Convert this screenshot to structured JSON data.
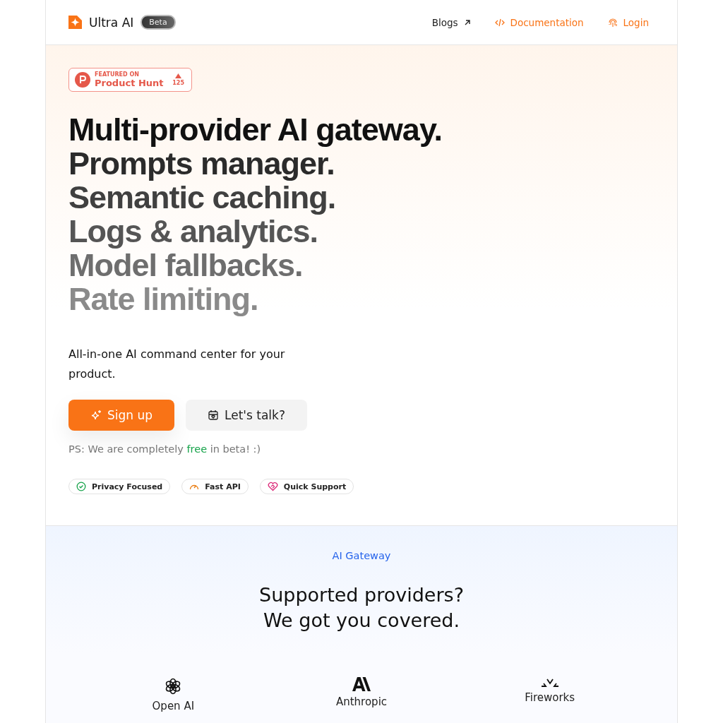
{
  "brand": {
    "name": "Ultra AI",
    "badge": "Beta"
  },
  "nav": [
    {
      "label": "Blogs",
      "kind": "external"
    },
    {
      "label": "Documentation",
      "kind": "code"
    },
    {
      "label": "Login",
      "kind": "fingerprint"
    }
  ],
  "product_hunt": {
    "featured": "FEATURED ON",
    "name": "Product Hunt",
    "votes": "125"
  },
  "headline": [
    "Multi-provider AI gateway.",
    "Prompts manager.",
    "Semantic caching.",
    "Logs & analytics.",
    "Model fallbacks.",
    "Rate limiting."
  ],
  "subtitle": "All-in-one AI command center for your product.",
  "buttons": [
    {
      "label": "Sign up",
      "kind": "primary"
    },
    {
      "label": "Let's talk?",
      "kind": "secondary"
    }
  ],
  "note": "PS: We are completely **free** in beta! :)",
  "features": [
    {
      "label": "Privacy Focused",
      "kind": "privacy"
    },
    {
      "label": "Fast API",
      "kind": "speed"
    },
    {
      "label": "Quick Support",
      "kind": "support"
    }
  ],
  "section": {
    "eyebrow": "AI Gateway",
    "title_lines": [
      "Supported providers?",
      "We got you covered."
    ]
  },
  "providers": [
    {
      "name": "Open AI",
      "kind": "openai"
    },
    {
      "name": "Anthropic",
      "kind": "anthropic"
    },
    {
      "name": "Fireworks",
      "kind": "fireworks"
    }
  ]
}
